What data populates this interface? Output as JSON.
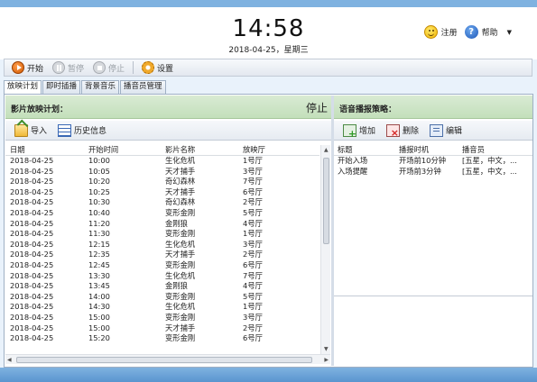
{
  "header": {
    "time": "14:58",
    "date": "2018-04-25，星期三",
    "register_label": "注册",
    "help_label": "帮助",
    "icons": {
      "register": "smiley-icon",
      "help": "help-icon",
      "menu": "chevron-down-icon"
    }
  },
  "toolbar": {
    "start_label": "开始",
    "pause_label": "暂停",
    "stop_label": "停止",
    "settings_label": "设置"
  },
  "tabs": [
    {
      "label": "放映计划",
      "active": true
    },
    {
      "label": "即时插播",
      "active": false
    },
    {
      "label": "背景音乐",
      "active": false
    },
    {
      "label": "播音员管理",
      "active": false
    }
  ],
  "schedule": {
    "title": "影片放映计划：",
    "status": "停止",
    "import_label": "导入",
    "history_label": "历史信息",
    "columns": [
      "日期",
      "开始时间",
      "影片名称",
      "放映厅"
    ],
    "rows": [
      [
        "2018-04-25",
        "10:00",
        "生化危机",
        "1号厅"
      ],
      [
        "2018-04-25",
        "10:05",
        "天才捕手",
        "3号厅"
      ],
      [
        "2018-04-25",
        "10:20",
        "奇幻森林",
        "7号厅"
      ],
      [
        "2018-04-25",
        "10:25",
        "天才捕手",
        "6号厅"
      ],
      [
        "2018-04-25",
        "10:30",
        "奇幻森林",
        "2号厅"
      ],
      [
        "2018-04-25",
        "10:40",
        "变形金刚",
        "5号厅"
      ],
      [
        "2018-04-25",
        "11:20",
        "金刚狼",
        "4号厅"
      ],
      [
        "2018-04-25",
        "11:30",
        "变形金刚",
        "1号厅"
      ],
      [
        "2018-04-25",
        "12:15",
        "生化危机",
        "3号厅"
      ],
      [
        "2018-04-25",
        "12:35",
        "天才捕手",
        "2号厅"
      ],
      [
        "2018-04-25",
        "12:45",
        "变形金刚",
        "6号厅"
      ],
      [
        "2018-04-25",
        "13:30",
        "生化危机",
        "7号厅"
      ],
      [
        "2018-04-25",
        "13:45",
        "金刚狼",
        "4号厅"
      ],
      [
        "2018-04-25",
        "14:00",
        "变形金刚",
        "5号厅"
      ],
      [
        "2018-04-25",
        "14:30",
        "生化危机",
        "1号厅"
      ],
      [
        "2018-04-25",
        "15:00",
        "变形金刚",
        "3号厅"
      ],
      [
        "2018-04-25",
        "15:00",
        "天才捕手",
        "2号厅"
      ],
      [
        "2018-04-25",
        "15:20",
        "变形金刚",
        "6号厅"
      ]
    ]
  },
  "voice": {
    "title": "语音播报策略：",
    "add_label": "增加",
    "delete_label": "删除",
    "edit_label": "编辑",
    "columns": [
      "标题",
      "播报时机",
      "播音员"
    ],
    "rows": [
      [
        "开始入场",
        "开场前10分钟",
        "[五星，中文，..."
      ],
      [
        "入场提醒",
        "开场前3分钟",
        "[五星，中文，..."
      ]
    ]
  }
}
